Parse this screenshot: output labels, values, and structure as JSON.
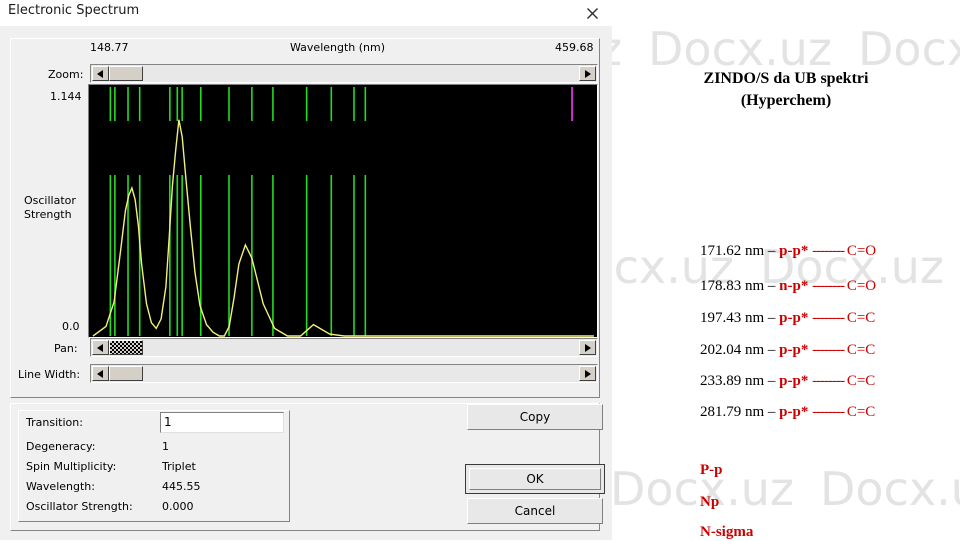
{
  "window": {
    "title": "Electronic Spectrum",
    "close_icon": "close-icon"
  },
  "graph": {
    "x_axis_label": "Wavelength (nm)",
    "x_min": "148.77",
    "x_max": "459.68",
    "y_axis_label_line1": "Oscillator",
    "y_axis_label_line2": "Strength",
    "y_max": "1.144",
    "y_min": "0.0",
    "controls": {
      "zoom_label": "Zoom:",
      "pan_label": "Pan:",
      "line_width_label": "Line Width:",
      "left_arrow_icon": "arrow-left-icon",
      "right_arrow_icon": "arrow-right-icon"
    }
  },
  "chart_data": {
    "type": "line",
    "title": "Electronic Spectrum",
    "xlabel": "Wavelength (nm)",
    "ylabel": "Oscillator Strength",
    "xlim": [
      148.77,
      459.68
    ],
    "ylim": [
      0.0,
      1.144
    ],
    "grid": false,
    "legend": "none",
    "series": [
      {
        "name": "Envelope (spectrum curve)",
        "color": "#f2f07a",
        "x": [
          150,
          158,
          163,
          167,
          170,
          172,
          174,
          176,
          178,
          180,
          183,
          186,
          189,
          192,
          195,
          197,
          199,
          201,
          203,
          205,
          207,
          210,
          213,
          216,
          220,
          224,
          228,
          231,
          234,
          237,
          240,
          244,
          248,
          255,
          262,
          270,
          275,
          278,
          282,
          286,
          290,
          296,
          305,
          320,
          340,
          360,
          400,
          440,
          459
        ],
        "y": [
          0.0,
          0.05,
          0.18,
          0.45,
          0.66,
          0.74,
          0.78,
          0.72,
          0.58,
          0.38,
          0.17,
          0.07,
          0.04,
          0.09,
          0.26,
          0.52,
          0.79,
          0.98,
          1.14,
          1.05,
          0.86,
          0.58,
          0.33,
          0.16,
          0.06,
          0.02,
          0.0,
          0.0,
          0.05,
          0.2,
          0.38,
          0.48,
          0.41,
          0.17,
          0.04,
          0.0,
          0.0,
          0.0,
          0.03,
          0.06,
          0.04,
          0.01,
          0.0,
          0.0,
          0.0,
          0.0,
          0.0,
          0.0,
          0.0
        ]
      }
    ],
    "stick_lines": {
      "name": "Transition sticks (top markers)",
      "color": "#22dd22",
      "highlight_color": "#cc33cc",
      "wavelengths_nm": [
        160.7,
        163.5,
        171.6,
        178.8,
        197.4,
        202.0,
        205.0,
        216.5,
        233.9,
        248.0,
        261.0,
        281.8,
        297.0,
        311.0,
        318.0,
        445.55
      ],
      "highlighted_wavelength_nm": 445.55
    }
  },
  "info": {
    "transition_label": "Transition:",
    "transition_value": "1",
    "degeneracy_label": "Degeneracy:",
    "degeneracy_value": "1",
    "spin_label": "Spin Multiplicity:",
    "spin_value": "Triplet",
    "wavelength_label": "Wavelength:",
    "wavelength_value": "445.55",
    "oscillator_label": "Oscillator Strength:",
    "oscillator_value": "0.000"
  },
  "buttons": {
    "copy": "Copy",
    "ok": "OK",
    "cancel": "Cancel"
  },
  "right_panel": {
    "title_line1": "ZINDO/S da UB spektri",
    "title_line2": "(Hyperchem)",
    "transitions": [
      {
        "wavelength": "171.62 nm",
        "dash": "–",
        "type": "p-p*",
        "dots": "--------",
        "bond": "C=O"
      },
      {
        "wavelength": "178.83 nm",
        "dash": "–",
        "type": "n-p*",
        "dots": "--------",
        "bond": "C=O"
      },
      {
        "wavelength": "197.43 nm",
        "dash": "–",
        "type": "p-p*",
        "dots": "--------",
        "bond": "C=C"
      },
      {
        "wavelength": "202.04 nm",
        "dash": "–",
        "type": "p-p*",
        "dots": "--------",
        "bond": "C=C"
      },
      {
        "wavelength": "233.89 nm",
        "dash": "–",
        "type": "p-p*",
        "dots": "--------",
        "bond": "C=C"
      },
      {
        "wavelength": "281.79 nm",
        "dash": "–",
        "type": "p-p*",
        "dots": "--------",
        "bond": "C=C"
      }
    ],
    "legend_items": [
      "P-p",
      "Np",
      "N-sigma"
    ]
  },
  "watermark": {
    "text": "Docx.uz"
  },
  "colors": {
    "accent_red": "#cc0000",
    "stick_green": "#22dd22",
    "stick_magenta": "#cc33cc",
    "curve_yellow": "#f2f07a",
    "plot_background": "#000000",
    "dialog_face": "#f0f0f0"
  }
}
